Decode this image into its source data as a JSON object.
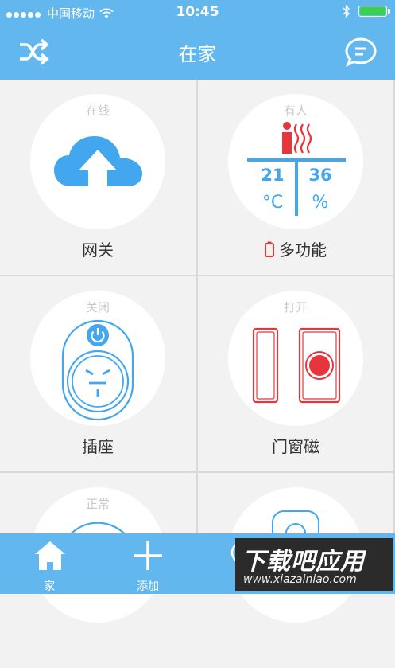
{
  "status_bar": {
    "carrier": "中国移动",
    "time": "10:45"
  },
  "nav": {
    "title": "在家"
  },
  "devices": [
    {
      "name": "网关",
      "state": "在线"
    },
    {
      "name": "多功能",
      "state": "有人",
      "temperature": "21",
      "temp_unit": "°C",
      "humidity": "36",
      "humidity_unit": "%"
    },
    {
      "name": "插座",
      "state": "关闭"
    },
    {
      "name": "门窗磁",
      "state": "打开"
    },
    {
      "name": "",
      "state": "正常"
    },
    {
      "name": "",
      "state": ""
    }
  ],
  "tabbar": {
    "home": "家",
    "add": "添加"
  },
  "watermark": {
    "main": "下载吧应用",
    "url": "www.xiazainiao.com"
  },
  "colors": {
    "accent": "#62b8ee",
    "alert": "#e8353b",
    "bg": "#f2f2f2"
  }
}
